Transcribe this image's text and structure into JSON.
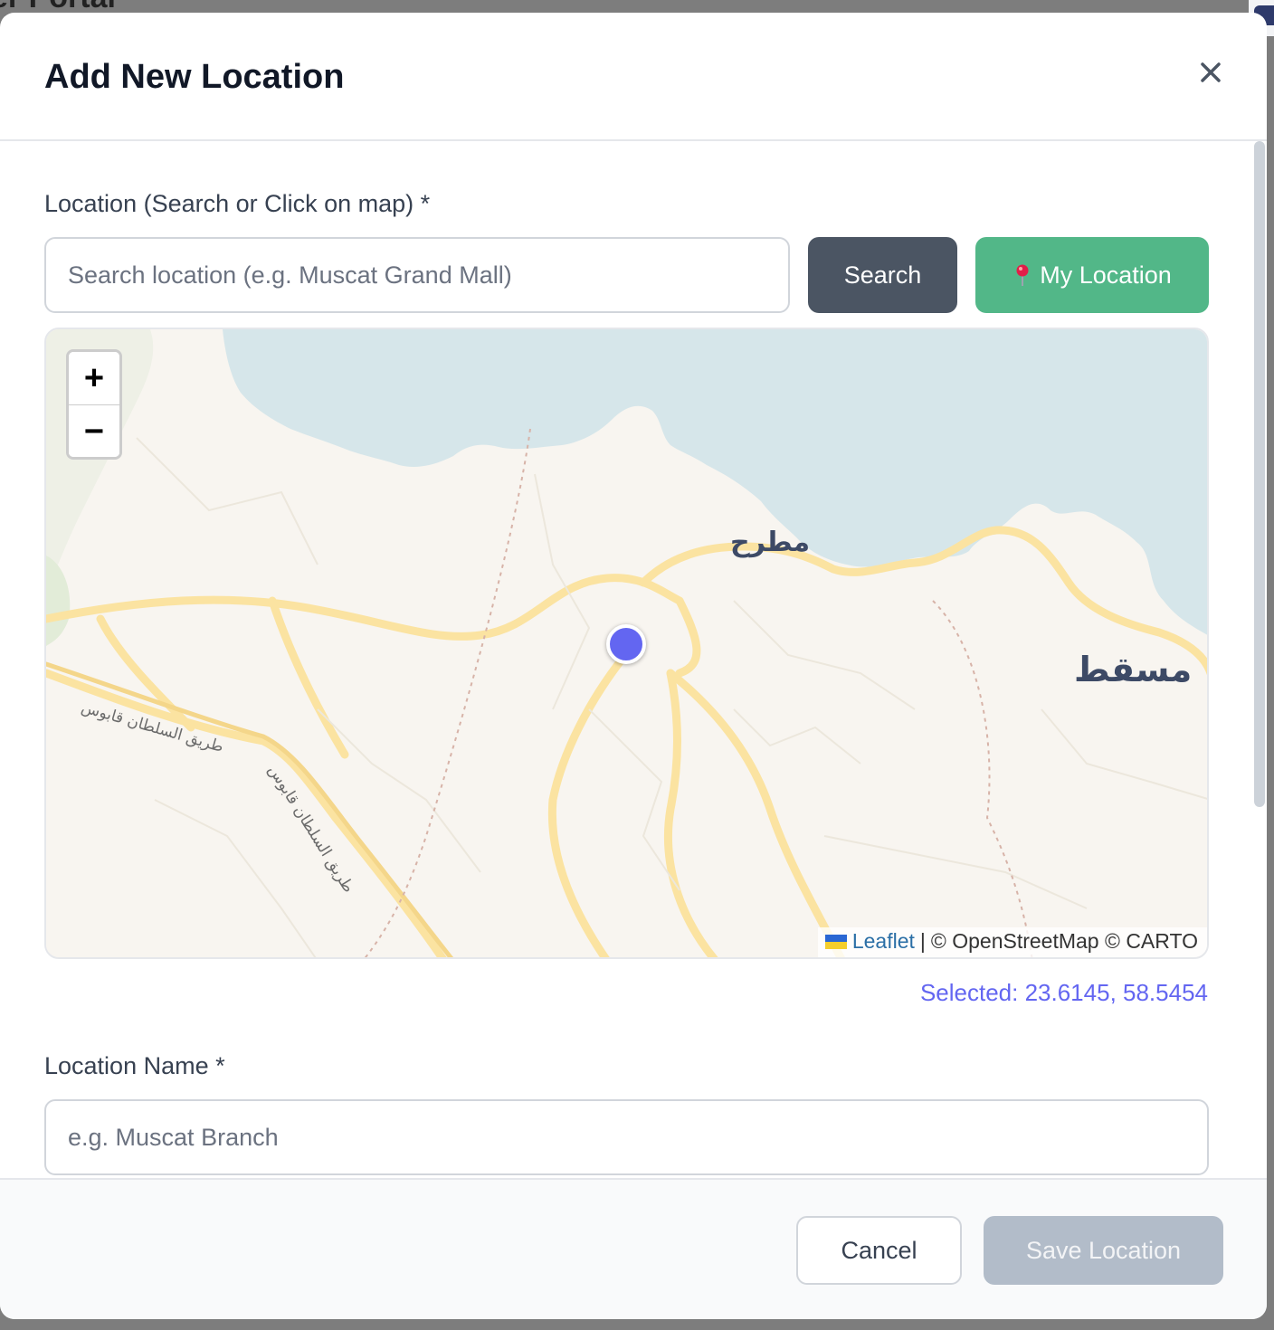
{
  "background": {
    "title": "er Portal"
  },
  "modal": {
    "title": "Add New Location",
    "close_label": "×"
  },
  "location_field": {
    "label": "Location (Search or Click on map) *",
    "search_placeholder": "Search location (e.g. Muscat Grand Mall)",
    "search_value": "",
    "search_button": "Search",
    "my_location_button": "My Location",
    "my_location_icon": "pin-icon"
  },
  "map": {
    "zoom_in": "+",
    "zoom_out": "−",
    "place_labels": {
      "mutrah": "مطرح",
      "muscat": "مسقط"
    },
    "road_labels": [
      "طريق السلطان قابوس",
      "طريق السلطان قابوس"
    ],
    "attribution": {
      "leaflet": "Leaflet",
      "separator": "|",
      "rest": "© OpenStreetMap © CARTO"
    },
    "colors": {
      "water": "#d6e6ea",
      "land": "#f8f5f0",
      "road": "#fbe3a1",
      "marker": "#6366f1"
    }
  },
  "selected_text": "Selected: 23.6145, 58.5454",
  "name_field": {
    "label": "Location Name *",
    "placeholder": "e.g. Muscat Branch",
    "value": ""
  },
  "footer": {
    "cancel": "Cancel",
    "save": "Save Location"
  }
}
